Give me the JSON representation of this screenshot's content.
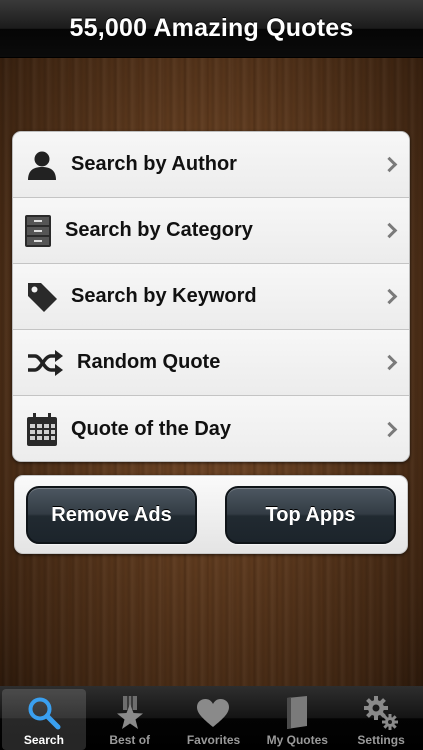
{
  "app": {
    "title": "55,000 Amazing Quotes"
  },
  "menu": {
    "items": [
      {
        "label": "Search by Author",
        "icon": "person-icon"
      },
      {
        "label": "Search by Category",
        "icon": "file-cabinet-icon"
      },
      {
        "label": "Search by Keyword",
        "icon": "tag-icon"
      },
      {
        "label": "Random Quote",
        "icon": "shuffle-icon"
      },
      {
        "label": "Quote of the Day",
        "icon": "calendar-icon"
      }
    ]
  },
  "buttons": {
    "remove_ads": "Remove Ads",
    "top_apps": "Top Apps"
  },
  "tabbar": {
    "selected": "Search",
    "tabs": [
      {
        "label": "Search",
        "icon": "magnifier-icon"
      },
      {
        "label": "Best of",
        "icon": "star-ribbon-icon"
      },
      {
        "label": "Favorites",
        "icon": "heart-icon"
      },
      {
        "label": "My Quotes",
        "icon": "book-icon"
      },
      {
        "label": "Settings",
        "icon": "gears-icon"
      }
    ]
  },
  "colors": {
    "accent_blue": "#3aa0f0",
    "wood": "#5e3a1e",
    "button_dark": "#2a333b"
  }
}
